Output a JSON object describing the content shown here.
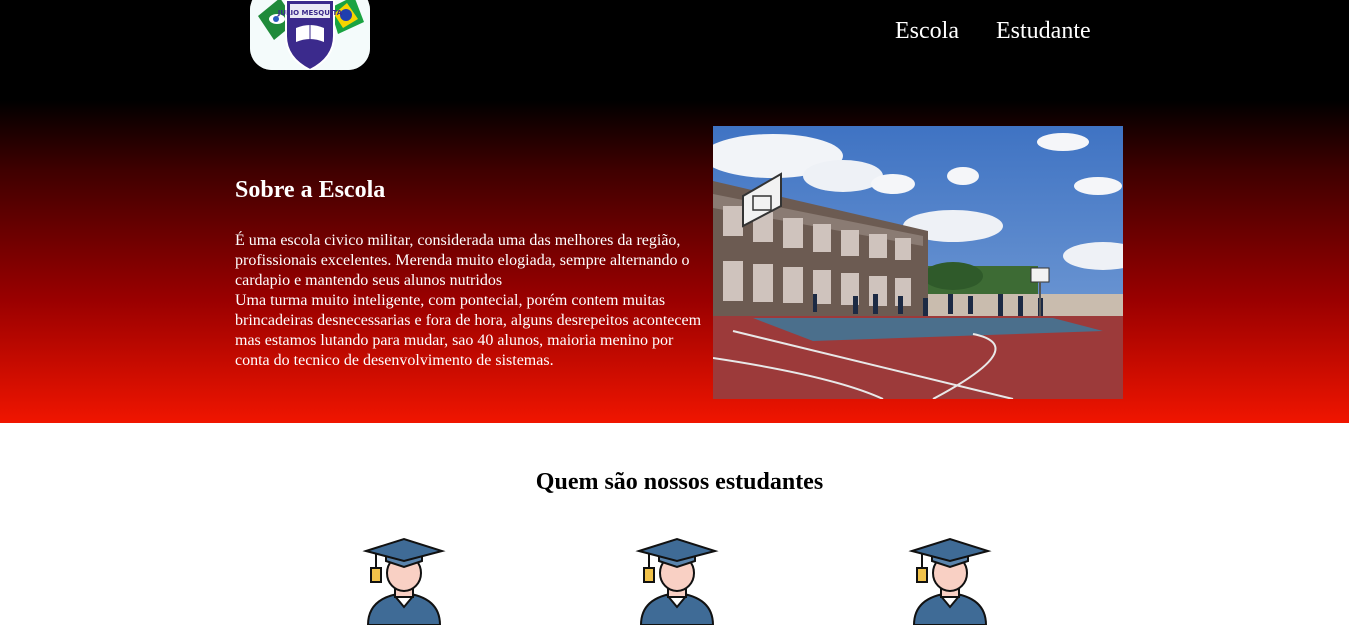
{
  "header": {
    "logo_name": "school-crest-logo",
    "nav": [
      {
        "label": "Escola"
      },
      {
        "label": "Estudante"
      }
    ]
  },
  "about": {
    "title": "Sobre a Escola",
    "paragraph1": "É uma escola civico militar, considerada uma das melhores da região, profissionais excelentes. Merenda muito elogiada, sempre alternando o cardapio e mantendo seus alunos nutridos",
    "paragraph2": "Uma turma muito inteligente, com pontecial, porém contem muitas brincadeiras desnecessarias e fora de hora, alguns desrepeitos acontecem mas estamos lutando para mudar, sao 40 alunos, maioria menino por conta do tecnico de desenvolvimento de sistemas."
  },
  "students": {
    "title": "Quem são nossos estudantes",
    "avatars": [
      "graduate-student-icon",
      "graduate-student-icon",
      "graduate-student-icon"
    ]
  },
  "colors": {
    "hero_top": "#000000",
    "hero_bottom": "#f01500",
    "text_light": "#ffffff",
    "cap_blue": "#3f6b96",
    "skin": "#f9d0c4"
  }
}
